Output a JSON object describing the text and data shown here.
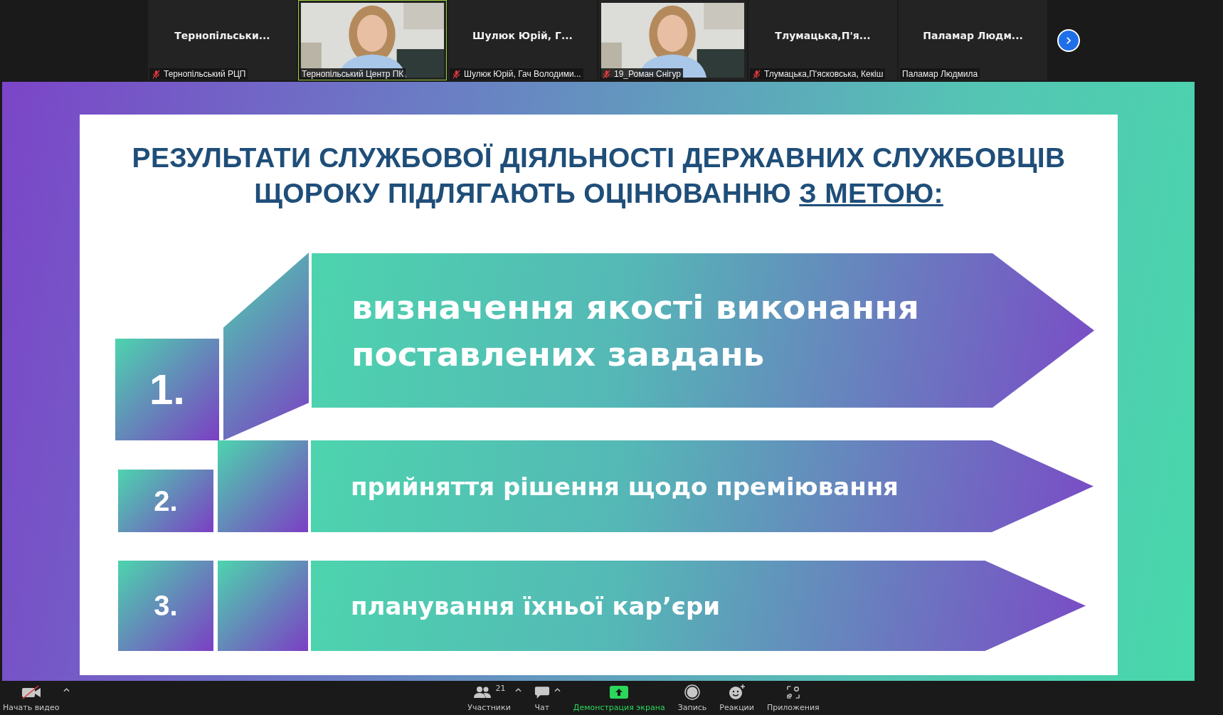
{
  "participants": [
    {
      "kind": "name",
      "display_name": "Тернопільськи...",
      "label": "Тернопільський РЦП",
      "muted": true,
      "speaking": false
    },
    {
      "kind": "video",
      "label": "Тернопільський Центр ПК",
      "muted": false,
      "speaking": true
    },
    {
      "kind": "name",
      "display_name": "Шулюк  Юрій, Г...",
      "label": "Шулюк Юрій, Гач Володими...",
      "muted": true,
      "speaking": false
    },
    {
      "kind": "video",
      "label": "19_Роман Снігур",
      "muted": true,
      "speaking": false
    },
    {
      "kind": "name",
      "display_name": "Тлумацька,П'я...",
      "label": "Тлумацька,П'ясковська, Кекіш",
      "muted": true,
      "speaking": false
    },
    {
      "kind": "name",
      "display_name": "Паламар  Людм...",
      "label": "Паламар Людмила",
      "muted": false,
      "speaking": false
    }
  ],
  "slide": {
    "title_lines": [
      [
        {
          "text": "РЕЗУЛЬТАТИ СЛУЖБОВОЇ ДІЯЛЬНОСТІ ДЕРЖАВНИХ СЛУЖБОВЦІВ",
          "underlined": false
        }
      ],
      [
        {
          "text": "ЩОРОКУ ПІДЛЯГАЮТЬ ОЦІНЮВАННЮ",
          "underlined": false
        },
        {
          "text": "З МЕТОЮ:",
          "underlined": true
        }
      ]
    ],
    "goals": [
      {
        "kind": "large",
        "number": "1.",
        "text": "визначення якості виконання поставлених завдань"
      },
      {
        "kind": "small",
        "number": "2.",
        "text": "прийняття рішення щодо преміювання"
      },
      {
        "kind": "small",
        "number": "3.",
        "text": "планування їхньої кар’єри"
      }
    ]
  },
  "toolbar": {
    "left": [
      {
        "kind": "video",
        "label": "Начать видео",
        "muted": true,
        "menu": true
      }
    ],
    "center": [
      {
        "kind": "participants",
        "label": "Участники",
        "count": "21",
        "menu": true
      },
      {
        "kind": "chat",
        "label": "Чат",
        "menu": true
      },
      {
        "kind": "share",
        "label": "Демонстрация экрана",
        "menu": false
      },
      {
        "kind": "record",
        "label": "Запись",
        "menu": false
      },
      {
        "kind": "reactions",
        "label": "Реакции",
        "menu": false
      },
      {
        "kind": "apps",
        "label": "Приложения",
        "menu": false
      }
    ]
  }
}
